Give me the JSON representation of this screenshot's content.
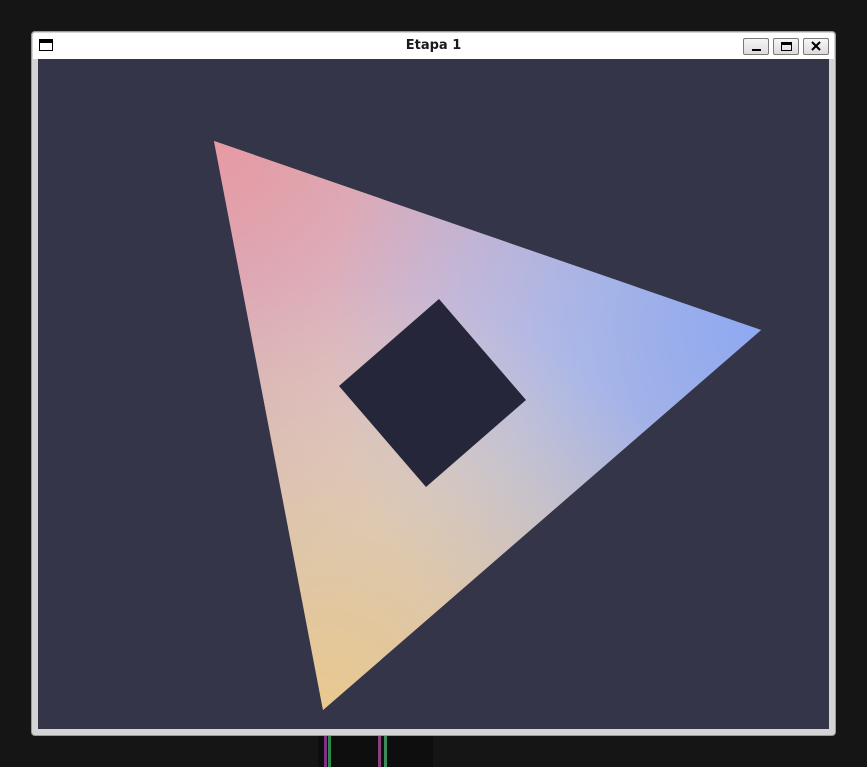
{
  "window": {
    "title": "Etapa 1"
  },
  "controls": {
    "icons": {
      "app": "window-icon",
      "minimize": "minimize-icon",
      "maximize": "maximize-icon",
      "close": "close-icon"
    }
  },
  "colors": {
    "canvas_background": "#343549",
    "vertex_top_left": "#e79aa3",
    "vertex_right": "#8ea9f2",
    "vertex_bottom": "#eac98f",
    "center_highlight": "#d9d9f0",
    "inner_square": "#25263a"
  }
}
